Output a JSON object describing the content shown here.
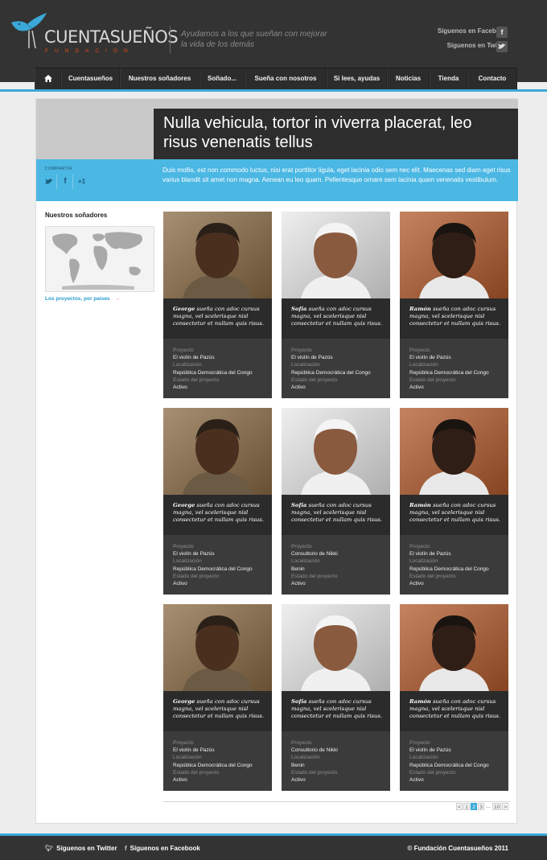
{
  "brand": {
    "name": "CUENTASUEÑOS",
    "sub": "FUNDACIÓN",
    "tagline": "Ayudamos a los que sueñan con mejorar la vida de los demás"
  },
  "social": {
    "facebook": "Síguenos en Facebook",
    "twitter": "Síguenos en Twitter"
  },
  "nav": [
    {
      "label": "Cuentasueños"
    },
    {
      "label": "Nuestros soñadores"
    },
    {
      "label": "Soñado..."
    },
    {
      "label": "Sueña con nosotros"
    },
    {
      "label": "Si lees, ayudas"
    },
    {
      "label": "Noticias"
    },
    {
      "label": "Tienda"
    },
    {
      "label": "Contacto"
    }
  ],
  "hero": {
    "title": "Nulla vehicula, tortor in viverra placerat, leo risus venenatis tellus",
    "description": "Duis mollis, est non commodo luctus, nisi erat porttitor ligula, eget lacinia odio sem nec elit. Maecenas sed diam eget risus varius blandit sit amet non magna. Aenean eu leo quam. Pellentesque ornare sem lacinia quam venenatis vestibulum.",
    "share_label": "COMPARTIR"
  },
  "sidebar": {
    "title": "Nuestros soñadores",
    "link": "Los proyectos, por países"
  },
  "labels": {
    "project": "Proyecto",
    "location": "Localización",
    "status": "Estado del proyecto"
  },
  "cards": [
    {
      "name": "George",
      "quote": "sueña con adoc cursus magna, vel scelerisque nisl consectetur et nullam quis risus.",
      "project": "El violín de Pazús",
      "location": "República Democrática del Congo",
      "status": "Activo"
    },
    {
      "name": "Sofía",
      "quote": "sueña con adoc cursus magna, vel scelerisque nisl consectetur et nullam quis risus.",
      "project": "El violín de Pazús",
      "location": "República Democrática del Congo",
      "status": "Activo"
    },
    {
      "name": "Ramón",
      "quote": "sueña con adoc cursus magna, vel scelerisque nisl consectetur et nullam quis risus.",
      "project": "El violín de Pazús",
      "location": "República Democrática del Congo",
      "status": "Activo"
    },
    {
      "name": "George",
      "quote": "sueña con adoc cursus magna, vel scelerisque nisl consectetur et nullam quis risus.",
      "project": "El violín de Pazús",
      "location": "República Democrática del Congo",
      "status": "Activo"
    },
    {
      "name": "Sofía",
      "quote": "sueña con adoc cursus magna, vel scelerisque nisl consectetur et nullam quis risus.",
      "project": "Consultorio de Nikki",
      "location": "Benin",
      "status": "Activo"
    },
    {
      "name": "Ramón",
      "quote": "sueña con adoc cursus magna, vel scelerisque nisl consectetur et nullam quis risus.",
      "project": "El violín de Pazús",
      "location": "República Democrática del Congo",
      "status": "Activo"
    },
    {
      "name": "George",
      "quote": "sueña con adoc cursus magna, vel scelerisque nisl consectetur et nullam quis risus.",
      "project": "El violín de Pazús",
      "location": "República Democrática del Congo",
      "status": "Activo"
    },
    {
      "name": "Sofía",
      "quote": "sueña con adoc cursus magna, vel scelerisque nisl consectetur et nullam quis risus.",
      "project": "Consultorio de Nikki",
      "location": "Benin",
      "status": "Activo"
    },
    {
      "name": "Ramón",
      "quote": "sueña con adoc cursus magna, vel scelerisque nisl consectetur et nullam quis risus.",
      "project": "El violín de Pazús",
      "location": "República Democrática del Congo",
      "status": "Activo"
    }
  ],
  "pagination": {
    "prev": "<",
    "pages": [
      "1",
      "2",
      "3"
    ],
    "dots": "...",
    "last": "10",
    "next": ">",
    "current": "2"
  },
  "footer": {
    "twitter": "Síguenos en Twitter",
    "facebook": "Síguenos en Facebook",
    "copyright": "© Fundación Cuentasueños 2011"
  },
  "colors": {
    "accent": "#3aa9d8",
    "brand_orange": "#e24c1b",
    "header": "#333333"
  }
}
